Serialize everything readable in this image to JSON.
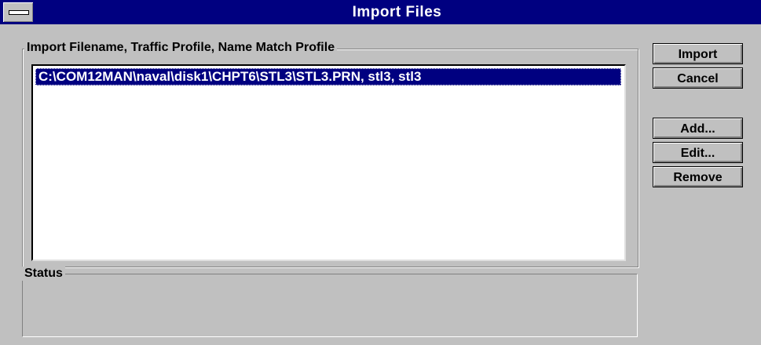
{
  "window": {
    "title": "Import Files"
  },
  "import_group": {
    "label": "Import Filename, Traffic Profile, Name Match Profile"
  },
  "file_list": {
    "items": [
      "C:\\COM12MAN\\naval\\disk1\\CHPT6\\STL3\\STL3.PRN, stl3, stl3"
    ],
    "selected_index": 0
  },
  "status_group": {
    "label": "Status",
    "text": ""
  },
  "buttons": {
    "import": "Import",
    "cancel": "Cancel",
    "add": "Add...",
    "edit": "Edit...",
    "remove": "Remove"
  },
  "colors": {
    "title_bar": "#000080",
    "selection": "#000080",
    "face": "#c0c0c0"
  },
  "icons": {
    "system_menu": "system-menu-icon"
  }
}
